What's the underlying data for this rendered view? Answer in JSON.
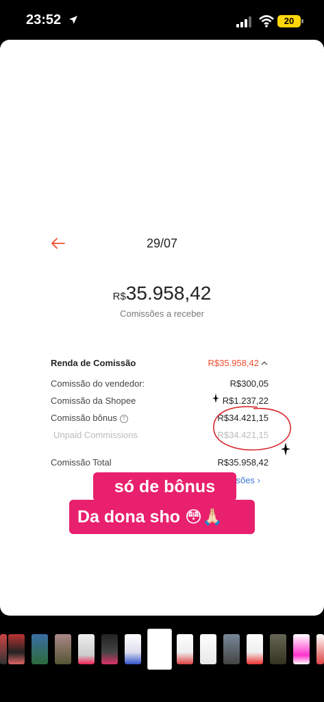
{
  "status": {
    "time": "23:52",
    "battery": "20"
  },
  "header": {
    "date": "29/07"
  },
  "summary": {
    "currency": "R$",
    "amount": "35.958,42",
    "caption": "Comissões a receber"
  },
  "details": {
    "title": "Renda de Comissão",
    "title_value": "R$35.958,42",
    "rows": [
      {
        "label": "Comissão do vendedor:",
        "value": "R$300,05"
      },
      {
        "label": "Comissão da Shopee",
        "value": "R$1.237,22"
      },
      {
        "label": "Comissão bônus",
        "value": "R$34.421,15"
      },
      {
        "label": "Unpaid Commissions",
        "value": "R$34.421,15"
      }
    ],
    "total_label": "Comissão Total",
    "total_value": "R$35.958,42",
    "link_partial": "ersões"
  },
  "caption": {
    "line1": "só de bônus",
    "line2": "Da dona sho",
    "emoji": "😳🙏🏻"
  },
  "colors": {
    "accent": "#ee4d2d",
    "caption_bg": "#e8206d",
    "link": "#3a7bd5"
  }
}
